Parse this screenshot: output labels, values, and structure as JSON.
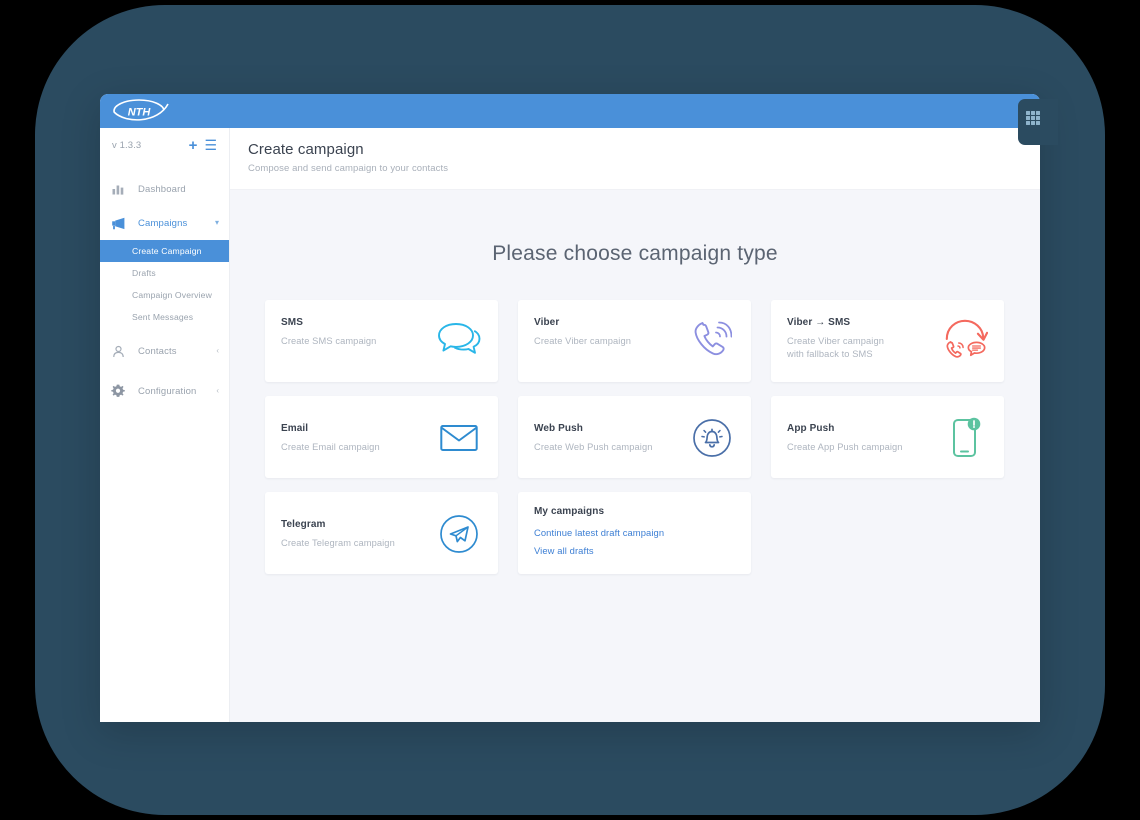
{
  "colors": {
    "backdrop": "#2b4b60",
    "topbar_blue": "#4a90d9",
    "accent": "#4a90d9",
    "page_bg": "#f5f6fa",
    "sms_icon": "#29b6e8",
    "viber_icon": "#8c8fe0",
    "viber_sms_icon": "#f4695e",
    "email_icon": "#2e8bd0",
    "webpush_icon": "#4a6fa8",
    "apppush_icon": "#5cc3a0",
    "telegram_icon": "#2e8bd0",
    "link_blue": "#3d7fd4"
  },
  "topbar": {
    "logo_text": "NTH",
    "grid_icon": "apps-grid-icon"
  },
  "sidebar": {
    "version": "v 1.3.3",
    "add_icon": "plus-icon",
    "menu_icon": "hamburger-menu-icon",
    "items": [
      {
        "label": "Dashboard",
        "icon": "bar-chart-icon",
        "active": false
      },
      {
        "label": "Campaigns",
        "icon": "megaphone-icon",
        "active": true,
        "chevron": "chevron-down-icon"
      },
      {
        "label": "Contacts",
        "icon": "user-icon",
        "active": false,
        "chevron": "chevron-left-icon"
      },
      {
        "label": "Configuration",
        "icon": "gear-icon",
        "active": false,
        "chevron": "chevron-left-icon"
      }
    ],
    "campaigns_subitems": [
      {
        "label": "Create Campaign",
        "selected": true
      },
      {
        "label": "Drafts",
        "selected": false
      },
      {
        "label": "Campaign Overview",
        "selected": false
      },
      {
        "label": "Sent Messages",
        "selected": false
      }
    ]
  },
  "page": {
    "title": "Create campaign",
    "subtitle": "Compose and send campaign to your contacts",
    "heading": "Please choose campaign type"
  },
  "cards": [
    {
      "title": "SMS",
      "subtitle": "Create SMS campaign",
      "icon": "chat-bubbles-icon",
      "color": "#29b6e8"
    },
    {
      "title": "Viber",
      "subtitle": "Create Viber campaign",
      "icon": "phone-ringing-icon",
      "color": "#8c8fe0"
    },
    {
      "title": "Viber → SMS",
      "subtitle": "Create Viber campaign\nwith fallback to SMS",
      "icon": "viber-fallback-sms-icon",
      "color": "#f4695e"
    },
    {
      "title": "Email",
      "subtitle": "Create Email campaign",
      "icon": "envelope-icon",
      "color": "#2e8bd0"
    },
    {
      "title": "Web Push",
      "subtitle": "Create Web Push campaign",
      "icon": "bell-circle-icon",
      "color": "#4a6fa8"
    },
    {
      "title": "App Push",
      "subtitle": "Create App Push campaign",
      "icon": "mobile-alert-icon",
      "color": "#5cc3a0"
    },
    {
      "title": "Telegram",
      "subtitle": "Create Telegram campaign",
      "icon": "paper-plane-circle-icon",
      "color": "#2e8bd0"
    }
  ],
  "my_campaigns": {
    "title": "My campaigns",
    "links": [
      "Continue latest draft campaign",
      "View all drafts"
    ]
  }
}
